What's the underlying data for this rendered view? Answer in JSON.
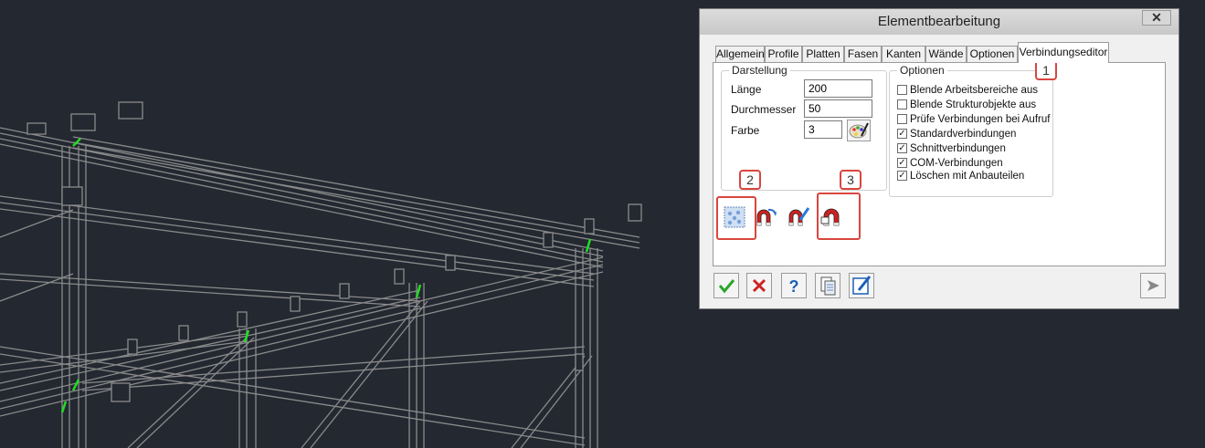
{
  "dialog": {
    "title": "Elementbearbeitung",
    "close_symbol": "✕"
  },
  "tabs": [
    {
      "label": "Allgemein",
      "active": false
    },
    {
      "label": "Profile",
      "active": false
    },
    {
      "label": "Platten",
      "active": false
    },
    {
      "label": "Fasen",
      "active": false
    },
    {
      "label": "Kanten",
      "active": false
    },
    {
      "label": "Wände",
      "active": false
    },
    {
      "label": "Optionen",
      "active": false
    },
    {
      "label": "Verbindungseditor",
      "active": true
    }
  ],
  "darstellung": {
    "legend": "Darstellung",
    "laenge_label": "Länge",
    "laenge_value": "200",
    "durchmesser_label": "Durchmesser",
    "durchmesser_value": "50",
    "farbe_label": "Farbe",
    "farbe_value": "3"
  },
  "optionen": {
    "legend": "Optionen",
    "items": [
      {
        "label": "Blende Arbeitsbereiche aus",
        "checked": false
      },
      {
        "label": "Blende Strukturobjekte aus",
        "checked": false
      },
      {
        "label": "Prüfe Verbindungen bei Aufruf",
        "checked": false
      },
      {
        "label": "Standardverbindungen",
        "checked": true
      },
      {
        "label": "Schnittverbindungen",
        "checked": true
      },
      {
        "label": "COM-Verbindungen",
        "checked": true
      },
      {
        "label": "Löschen mit Anbauteilen",
        "checked": true
      }
    ]
  },
  "callouts": {
    "one": "1",
    "two": "2",
    "three": "3"
  },
  "colors": {
    "background": "#232831",
    "wireframe": "#8a8a8a",
    "connection_marker": "#22dd22",
    "callout": "#d9463f"
  }
}
